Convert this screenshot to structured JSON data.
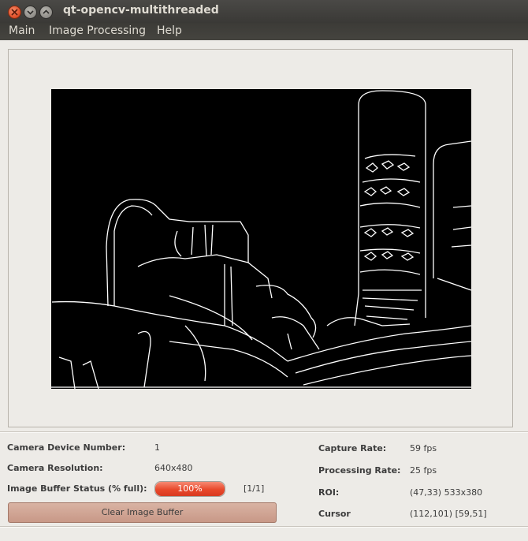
{
  "window": {
    "title": "qt-opencv-multithreaded"
  },
  "menu": [
    "Main",
    "Image Processing",
    "Help"
  ],
  "info": {
    "device_label": "Camera Device Number:",
    "device_value": "1",
    "resolution_label": "Camera Resolution:",
    "resolution_value": "640x480",
    "buffer_label": "Image Buffer Status (% full):",
    "buffer_percent_text": "100%",
    "buffer_fill": 1.0,
    "buffer_count": "[1/1]",
    "clear_button": "Clear Image Buffer",
    "capture_label": "Capture Rate:",
    "capture_value": "59 fps",
    "processing_label": "Processing Rate:",
    "processing_value": "25 fps",
    "roi_label": "ROI:",
    "roi_value": "(47,33) 533x380",
    "cursor_label": "Cursor",
    "cursor_value": "(112,101) [59,51]"
  },
  "colors": {
    "progress_fill": "#e8482b",
    "close_button": "#e0512a",
    "frame_background": "#000000",
    "edge_lines": "#ffffff"
  }
}
